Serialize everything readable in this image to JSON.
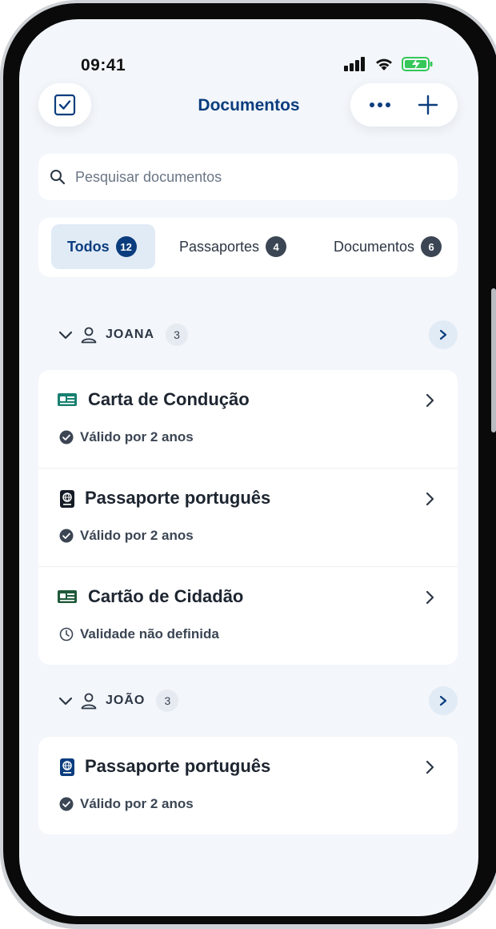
{
  "status_bar": {
    "time": "09:41"
  },
  "nav": {
    "title": "Documentos"
  },
  "search": {
    "placeholder": "Pesquisar documentos"
  },
  "tabs": [
    {
      "label": "Todos",
      "count": "12",
      "active": true
    },
    {
      "label": "Passaportes",
      "count": "4"
    },
    {
      "label": "Documentos",
      "count": "6"
    }
  ],
  "groups": [
    {
      "name": "JOANA",
      "count": "3",
      "items": [
        {
          "title": "Carta de Condução",
          "status": "Válido por 2 anos",
          "icon": "id-card-icon",
          "status_icon": "check-circle-icon"
        },
        {
          "title": "Passaporte português",
          "status": "Válido por 2 anos",
          "icon": "passport-icon",
          "status_icon": "check-circle-icon"
        },
        {
          "title": "Cartão de Cidadão",
          "status": "Validade não definida",
          "icon": "id-card-icon",
          "status_icon": "clock-icon"
        }
      ]
    },
    {
      "name": "JOÃO",
      "count": "3",
      "items": [
        {
          "title": "Passaporte português",
          "status": "Válido por 2 anos",
          "icon": "passport-icon",
          "status_icon": "check-circle-icon"
        }
      ]
    }
  ],
  "colors": {
    "accent": "#0b3d7e",
    "background": "#f3f6fa",
    "teal_icon": "#17806f",
    "green_icon": "#1f5a3a"
  }
}
